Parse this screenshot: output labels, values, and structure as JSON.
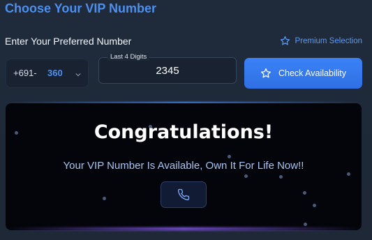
{
  "header": {
    "title": "Choose Your VIP Number"
  },
  "form": {
    "label": "Enter Your Preferred Number",
    "premium_label": "Premium Selection",
    "premium_icon": "star-icon",
    "prefix": "+691-",
    "area_code": "360",
    "area_dropdown_icon": "chevron-down-icon",
    "digits_legend": "Last 4 Digits",
    "digits_value": "2345",
    "check_button_label": "Check Availability",
    "check_button_icon": "star-icon"
  },
  "result": {
    "heading": "Congratulations!",
    "message": "Your VIP Number Is Available, Own It For Life Now!!",
    "call_icon": "phone-icon"
  },
  "colors": {
    "accent": "#4d8fee",
    "button": "#3b82f6",
    "card_background": "#03050a",
    "glow_bottom": "#8b5cf6"
  }
}
